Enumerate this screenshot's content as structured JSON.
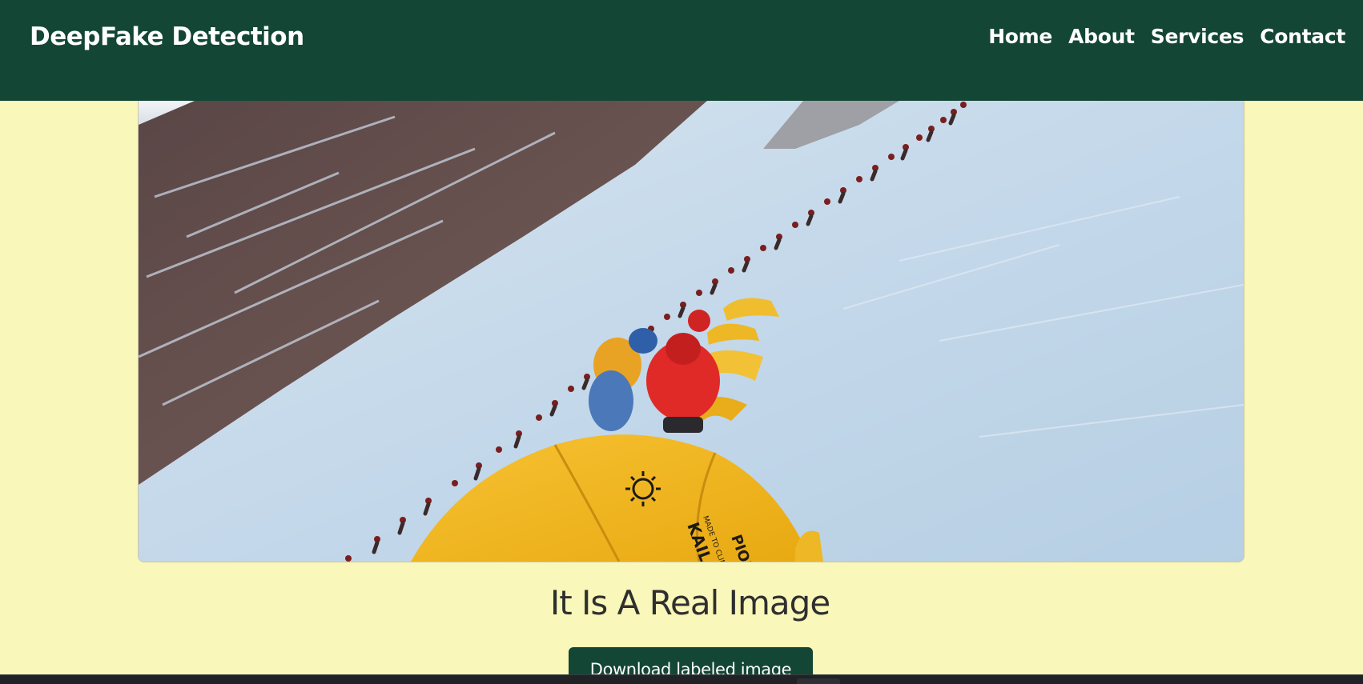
{
  "navbar": {
    "brand": "DeepFake Detection",
    "links": [
      "Home",
      "About",
      "Services",
      "Contact"
    ]
  },
  "result": {
    "title": "It Is A Real Image",
    "download_label": "Download labeled image"
  },
  "image": {
    "subject": "mountaineers-on-snowy-slope-photo",
    "tent_text_1": "KAILAS",
    "tent_text_2": "MADE TO CLIMB",
    "tent_text_3": "PIONEER"
  },
  "colors": {
    "navbar_bg": "#134634",
    "page_bg": "#f9f7b9",
    "button_bg": "#134634",
    "title_text": "#2f2f2f"
  }
}
